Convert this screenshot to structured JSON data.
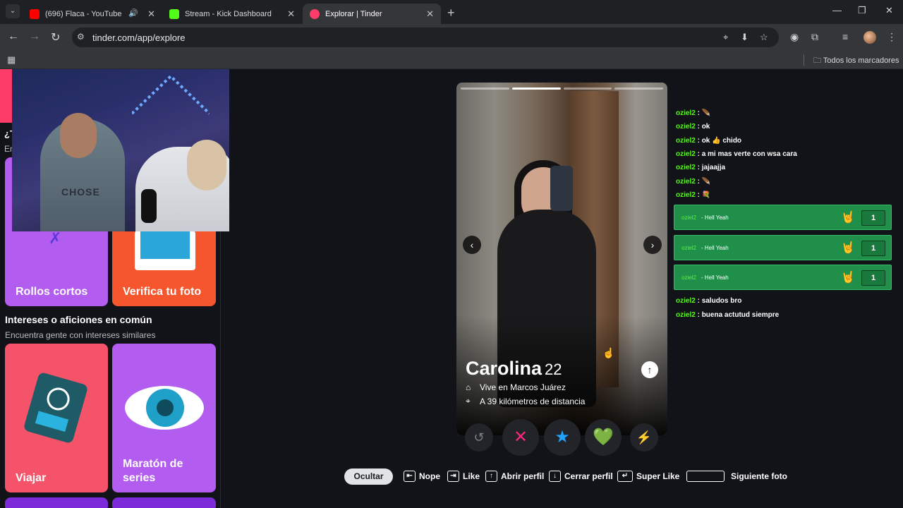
{
  "browser": {
    "tabs": [
      {
        "label": "(696) Flaca - YouTube",
        "favicon_color": "#ff0000"
      },
      {
        "label": "Stream - Kick Dashboard",
        "favicon_color": "#53fc18"
      },
      {
        "label": "Explorar | Tinder",
        "favicon_color": "#fe3c6a"
      }
    ],
    "url": "tinder.com/app/explore",
    "bookmarks_folder": "Todos los marcadores"
  },
  "sidebar": {
    "peek_title": "¿T",
    "peek_sub": "En",
    "cards_top": [
      {
        "label": "Rollos cortos",
        "color": "#b35cf0"
      },
      {
        "label": "Verifica tu foto",
        "color": "#f5562d"
      }
    ],
    "section_title": "Intereses o aficiones en común",
    "section_sub": "Encuentra gente con intereses similares",
    "cards_bottom": [
      {
        "label": "Viajar",
        "color": "#f4536a"
      },
      {
        "label": "Maratón de series",
        "color": "#b35cf0"
      }
    ]
  },
  "webcam": {
    "shirt_text": "CHOSE"
  },
  "profile": {
    "name": "Carolina",
    "age": "22",
    "lives": "Vive en Marcos Juárez",
    "distance": "A 39 kilómetros de distancia",
    "photo_count": 4,
    "photo_active": 1
  },
  "actions": [
    {
      "icon": "rewind-icon",
      "glyph": "↺",
      "color": "#7d8088"
    },
    {
      "icon": "nope-x-icon",
      "glyph": "✕",
      "color": "#fd267d"
    },
    {
      "icon": "super-like-star-icon",
      "glyph": "★",
      "color": "#1ea3ff"
    },
    {
      "icon": "like-heart-icon",
      "glyph": "💚",
      "color": "#62e08f"
    },
    {
      "icon": "boost-bolt-icon",
      "glyph": "⚡",
      "color": "#b36bff"
    }
  ],
  "chat": {
    "messages": [
      {
        "user": "oziel2",
        "text": "🪶"
      },
      {
        "user": "oziel2",
        "text": "ok"
      },
      {
        "user": "oziel2",
        "text": "ok 👍 chido"
      },
      {
        "user": "oziel2",
        "text": "a mi mas verte con wsa cara"
      },
      {
        "user": "oziel2",
        "text": "jajaajja"
      },
      {
        "user": "oziel2",
        "text": "🪶"
      },
      {
        "user": "oziel2",
        "text": "💐"
      }
    ],
    "alerts": [
      {
        "user": "oziel2",
        "text": "- Hell Yeah",
        "emoji": "🤘",
        "count": "1"
      },
      {
        "user": "oziel2",
        "text": "- Hell Yeah",
        "emoji": "🤘",
        "count": "1"
      },
      {
        "user": "oziel2",
        "text": "- Hell Yeah",
        "emoji": "🤘",
        "count": "1"
      }
    ],
    "after": [
      {
        "user": "oziel2",
        "text": "saludos bro"
      },
      {
        "user": "oziel2",
        "text": "buena actutud siempre"
      }
    ]
  },
  "shortcuts": {
    "hide": "Ocultar",
    "nope": "Nope",
    "like": "Like",
    "open": "Abrir perfil",
    "close": "Cerrar perfil",
    "super": "Super Like",
    "next": "Siguiente foto"
  }
}
